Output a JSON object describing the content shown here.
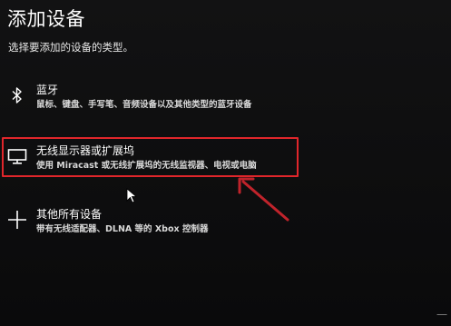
{
  "dialog": {
    "title": "添加设备",
    "subtitle": "选择要添加的设备的类型。"
  },
  "options": [
    {
      "icon": "bluetooth-icon",
      "label": "蓝牙",
      "desc": "鼠标、键盘、手写笔、音频设备以及其他类型的蓝牙设备"
    },
    {
      "icon": "monitor-icon",
      "label": "无线显示器或扩展坞",
      "desc": "使用 Miracast 或无线扩展坞的无线监视器、电视或电脑"
    },
    {
      "icon": "plus-icon",
      "label": "其他所有设备",
      "desc": "带有无线适配器、DLNA 等的 Xbox 控制器"
    }
  ],
  "annotation": {
    "highlight_color": "#e0262b",
    "arrow_color": "#c0232b"
  },
  "corner": {
    "glyph": "一"
  }
}
